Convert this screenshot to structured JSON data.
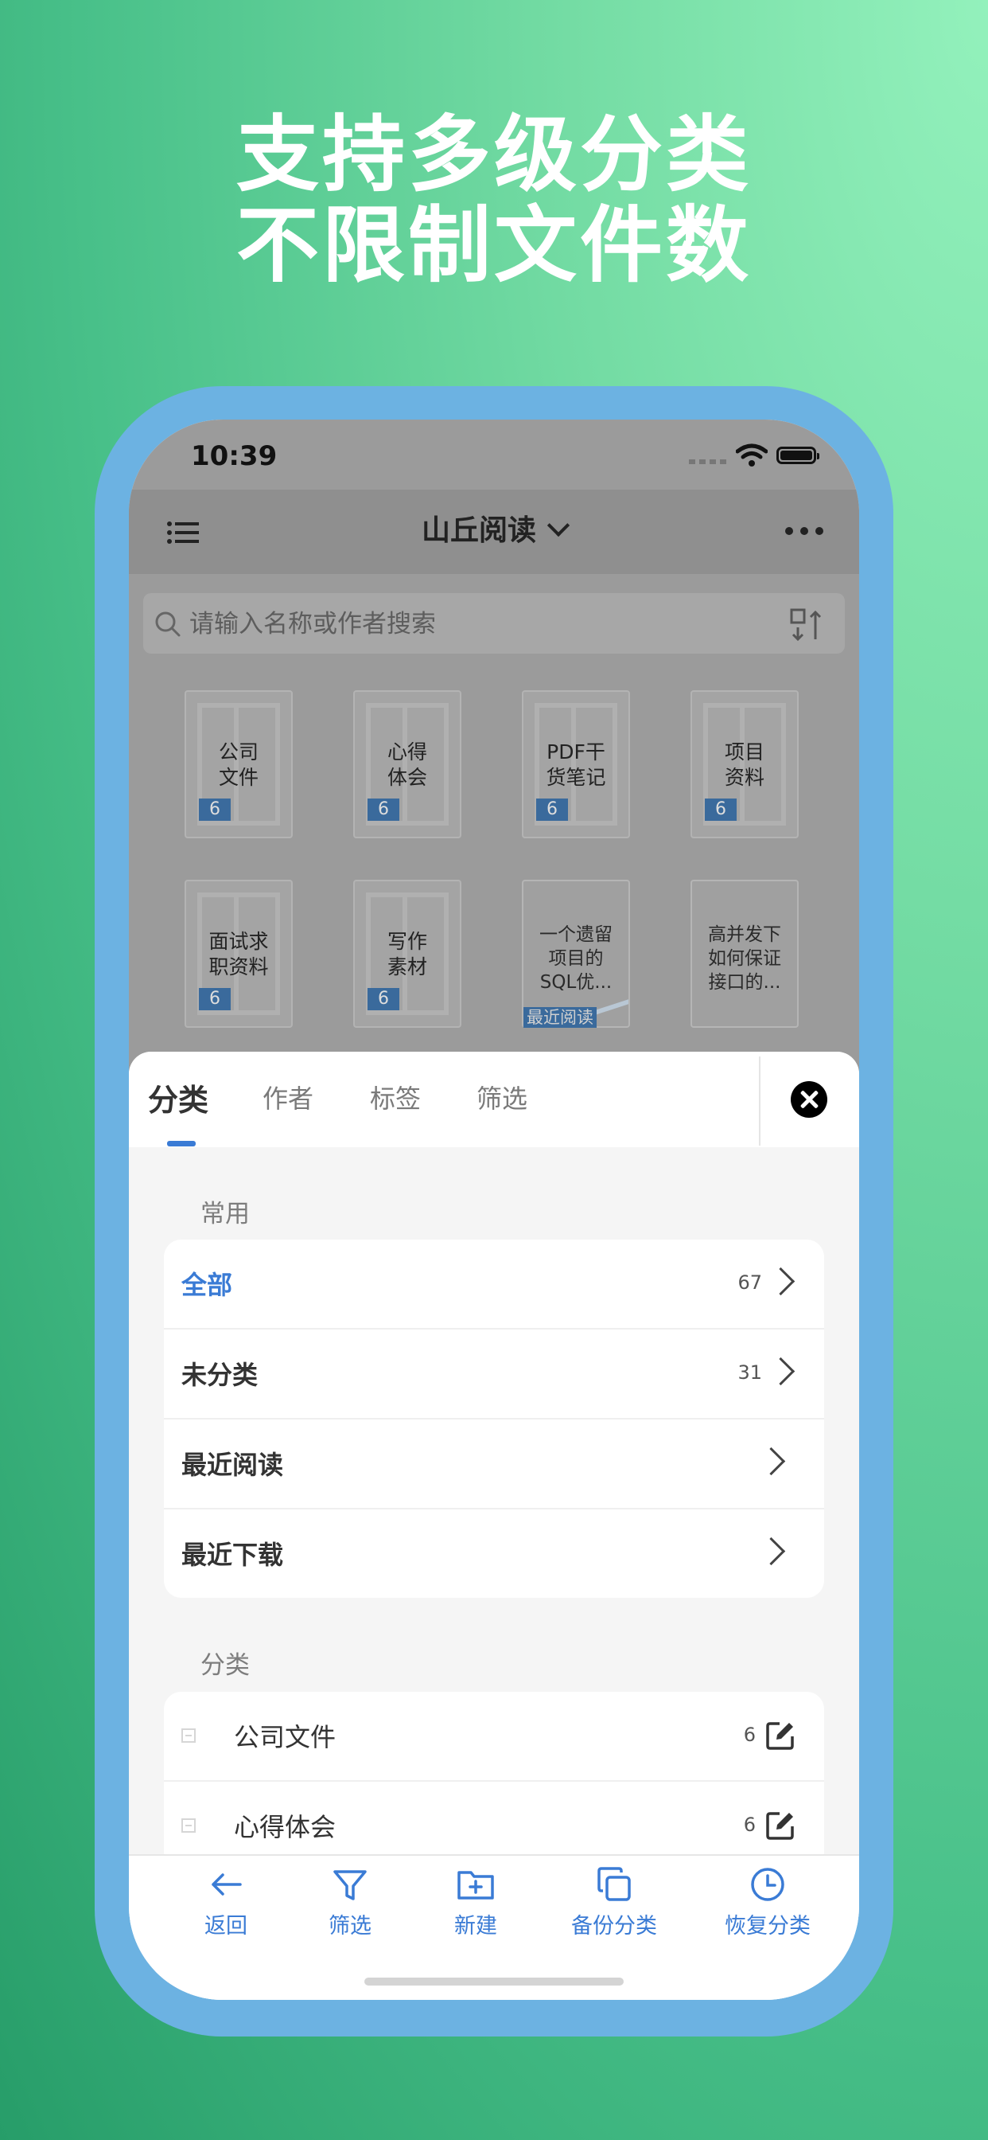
{
  "headline": {
    "line1": "支持多级分类",
    "line2": "不限制文件数"
  },
  "status": {
    "time": "10:39"
  },
  "nav": {
    "title": "山丘阅读"
  },
  "search": {
    "placeholder": "请输入名称或作者搜索"
  },
  "books": [
    {
      "title_line1": "公司",
      "title_line2": "文件",
      "count": "6"
    },
    {
      "title_line1": "心得",
      "title_line2": "体会",
      "count": "6"
    },
    {
      "title_line1": "PDF干",
      "title_line2": "货笔记",
      "count": "6"
    },
    {
      "title_line1": "项目",
      "title_line2": "资料",
      "count": "6"
    },
    {
      "title_line1": "面试求",
      "title_line2": "职资料",
      "count": "6"
    },
    {
      "title_line1": "写作",
      "title_line2": "素材",
      "count": "6"
    }
  ],
  "docs": [
    {
      "title_line1": "一个遗留",
      "title_line2": "项目的",
      "title_line3": "SQL优...",
      "badge": "最近阅读"
    },
    {
      "title_line1": "高并发下",
      "title_line2": "如何保证",
      "title_line3": "接口的..."
    }
  ],
  "sheet": {
    "tabs": [
      "分类",
      "作者",
      "标签",
      "筛选"
    ],
    "common_header": "常用",
    "common_rows": [
      {
        "label": "全部",
        "count": "67"
      },
      {
        "label": "未分类",
        "count": "31"
      },
      {
        "label": "最近阅读"
      },
      {
        "label": "最近下载"
      }
    ],
    "category_header": "分类",
    "category_rows": [
      {
        "label": "公司文件",
        "count": "6"
      },
      {
        "label": "心得体会",
        "count": "6"
      }
    ]
  },
  "toolbar": {
    "items": [
      "返回",
      "筛选",
      "新建",
      "备份分类",
      "恢复分类"
    ]
  }
}
